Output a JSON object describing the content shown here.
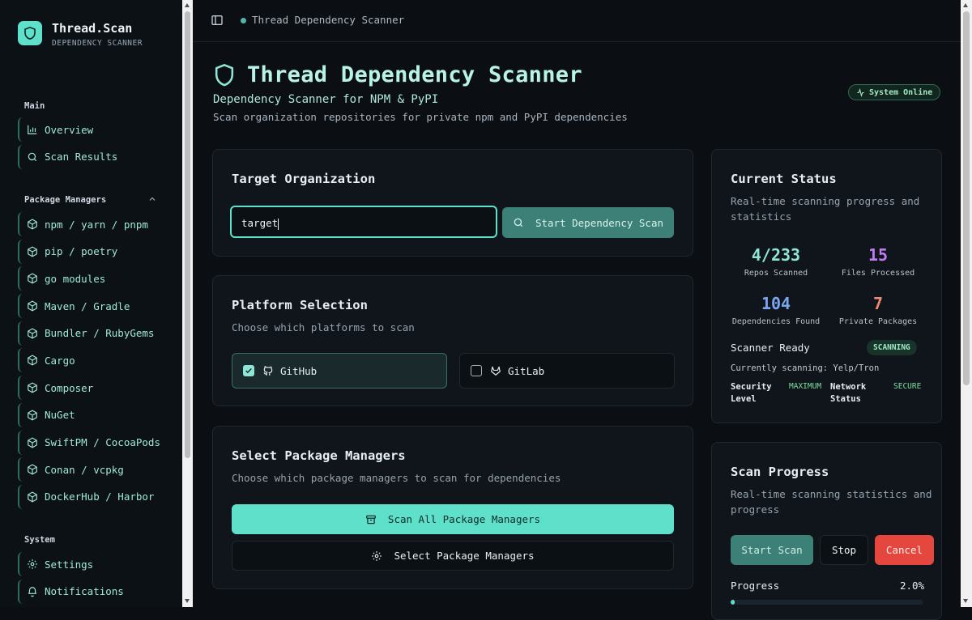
{
  "brand": {
    "name": "Thread.Scan",
    "subtitle": "DEPENDENCY SCANNER"
  },
  "sidebar": {
    "main_title": "Main",
    "main_items": [
      {
        "label": "Overview",
        "icon": "bar-chart-icon"
      },
      {
        "label": "Scan Results",
        "icon": "search-icon"
      }
    ],
    "pm_title": "Package Managers",
    "pm_items": [
      {
        "label": "npm / yarn / pnpm",
        "icon": "package-icon"
      },
      {
        "label": "pip / poetry",
        "icon": "package-icon"
      },
      {
        "label": "go modules",
        "icon": "package-icon"
      },
      {
        "label": "Maven / Gradle",
        "icon": "package-icon"
      },
      {
        "label": "Bundler / RubyGems",
        "icon": "package-icon"
      },
      {
        "label": "Cargo",
        "icon": "package-icon"
      },
      {
        "label": "Composer",
        "icon": "package-icon"
      },
      {
        "label": "NuGet",
        "icon": "package-icon"
      },
      {
        "label": "SwiftPM / CocoaPods",
        "icon": "package-icon"
      },
      {
        "label": "Conan / vcpkg",
        "icon": "package-icon"
      },
      {
        "label": "DockerHub / Harbor",
        "icon": "package-icon"
      }
    ],
    "system_title": "System",
    "system_items": [
      {
        "label": "Settings",
        "icon": "gear-icon"
      },
      {
        "label": "Notifications",
        "icon": "bell-icon"
      }
    ]
  },
  "topbar": {
    "breadcrumb": "Thread Dependency Scanner"
  },
  "header": {
    "title": "Thread Dependency Scanner",
    "subtitle": "Dependency Scanner for NPM & PyPI",
    "description": "Scan organization repositories for private npm and PyPI dependencies",
    "status_badge": "System Online"
  },
  "target": {
    "heading": "Target Organization",
    "input_value": "target",
    "scan_button": "Start Dependency Scan"
  },
  "platform": {
    "heading": "Platform Selection",
    "description": "Choose which platforms to scan",
    "options": [
      {
        "label": "GitHub",
        "checked": true
      },
      {
        "label": "GitLab",
        "checked": false
      }
    ]
  },
  "package_managers": {
    "heading": "Select Package Managers",
    "description": "Choose which package managers to scan for dependencies",
    "scan_all_button": "Scan All Package Managers",
    "select_button": "Select Package Managers"
  },
  "status": {
    "heading": "Current Status",
    "description_line1": "Real-time scanning progress and",
    "description_line2": "statistics",
    "stats": [
      {
        "value": "4/233",
        "label": "Repos Scanned",
        "color": "#8ee7d6"
      },
      {
        "value": "15",
        "label": "Files Processed",
        "color": "#c07cf0"
      },
      {
        "value": "104",
        "label": "Dependencies Found",
        "color": "#7aa6f0"
      },
      {
        "value": "7",
        "label": "Private Packages",
        "color": "#f08a72"
      }
    ],
    "ready_label": "Scanner Ready",
    "scanning_badge": "SCANNING",
    "currently": "Currently scanning: Yelp/Tron",
    "security_label_1": "Security",
    "security_label_2": "Level",
    "security_value": "MAXIMUM",
    "network_label_1": "Network",
    "network_label_2": "Status",
    "network_value": "SECURE"
  },
  "progress": {
    "heading": "Scan Progress",
    "description_line1": "Real-time scanning statistics and",
    "description_line2": "progress",
    "start_button": "Start Scan",
    "stop_button": "Stop",
    "cancel_button": "Cancel",
    "label": "Progress",
    "percent_text": "2.0%",
    "percent_value": 2.0
  },
  "colors": {
    "accent": "#5fe0cb",
    "accent_dark": "#3d8077",
    "danger": "#e5473e",
    "background": "#0b0f14"
  }
}
